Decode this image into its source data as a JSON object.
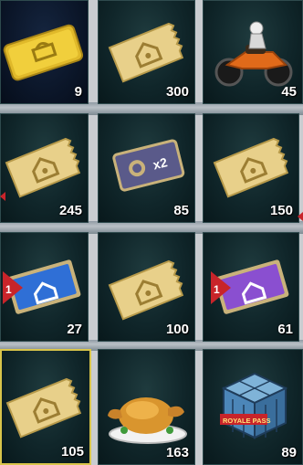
{
  "inventory": {
    "items": [
      {
        "name": "gold-name-card",
        "count": "9"
      },
      {
        "name": "classic-crate-coupon",
        "count": "300"
      },
      {
        "name": "motorcycle-skin",
        "count": "45"
      },
      {
        "name": "classic-crate-coupon",
        "count": "245"
      },
      {
        "name": "double-bp-card",
        "count": "85",
        "label": "x2"
      },
      {
        "name": "classic-crate-coupon",
        "count": "150"
      },
      {
        "name": "premium-crate-coupon-blue",
        "count": "27",
        "badge": "1"
      },
      {
        "name": "classic-crate-coupon",
        "count": "100"
      },
      {
        "name": "premium-crate-coupon-purple",
        "count": "61",
        "badge": "1"
      },
      {
        "name": "classic-crate-coupon",
        "count": "105"
      },
      {
        "name": "chicken-dinner",
        "count": "163"
      },
      {
        "name": "royale-pass-cube",
        "count": "89",
        "label": "ROYALE PASS"
      }
    ]
  },
  "colors": {
    "coupon_gold": "#e8d08a",
    "selection_border": "#d8c44a",
    "premium_blue": "#2f6fd6",
    "premium_purple": "#8a4fd0",
    "badge_red": "#c8242a"
  }
}
